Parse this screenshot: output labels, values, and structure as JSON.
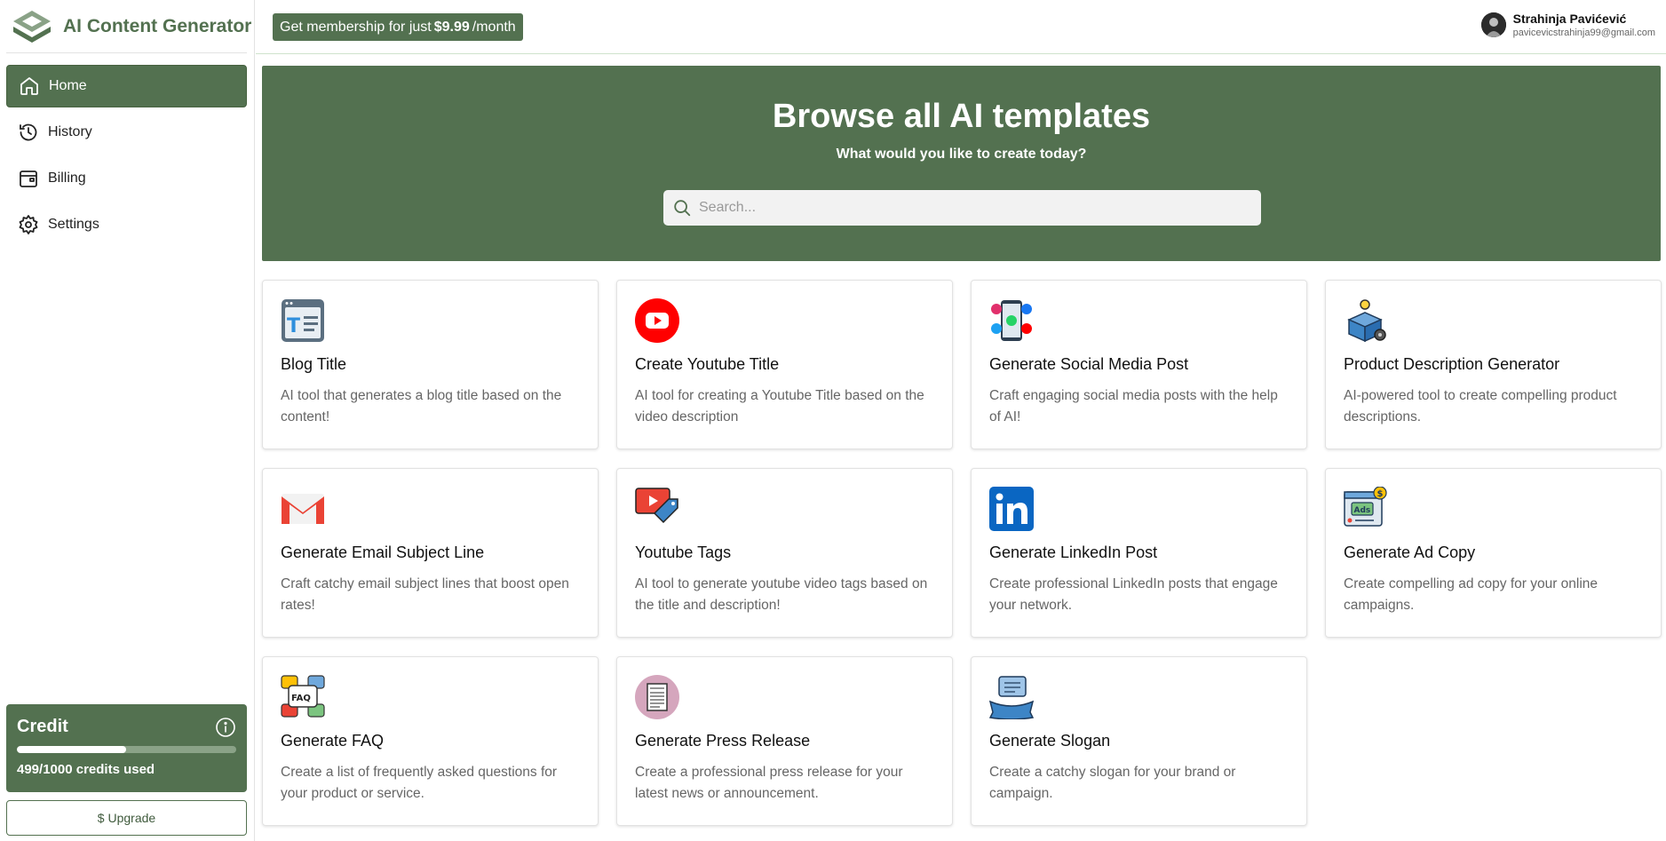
{
  "app": {
    "title": "AI Content Generator"
  },
  "sidebar": {
    "items": [
      {
        "label": "Home",
        "icon": "home-icon",
        "active": true
      },
      {
        "label": "History",
        "icon": "history-icon",
        "active": false
      },
      {
        "label": "Billing",
        "icon": "billing-icon",
        "active": false
      },
      {
        "label": "Settings",
        "icon": "gear-icon",
        "active": false
      }
    ]
  },
  "credit": {
    "title": "Credit",
    "used": 499,
    "total": 1000,
    "progress_fraction": 0.499,
    "text": "499/1000 credits used",
    "upgrade_label": "$ Upgrade"
  },
  "header": {
    "promo_prefix": "Get membership for just",
    "promo_price": "$9.99",
    "promo_suffix": "/month",
    "user_name": "Strahinja Pavićević",
    "user_email": "pavicevicstrahinja99@gmail.com"
  },
  "hero": {
    "title": "Browse all AI templates",
    "subtitle": "What would you like to create today?",
    "search_placeholder": "Search...",
    "search_value": ""
  },
  "templates": [
    {
      "title": "Blog Title",
      "desc": "AI tool that generates a blog title based on the content!",
      "icon": "blog-title-icon"
    },
    {
      "title": "Create Youtube Title",
      "desc": "AI tool for creating a Youtube Title based on the video description",
      "icon": "youtube-icon"
    },
    {
      "title": "Generate Social Media Post",
      "desc": "Craft engaging social media posts with the help of AI!",
      "icon": "social-media-icon"
    },
    {
      "title": "Product Description Generator",
      "desc": "AI-powered tool to create compelling product descriptions.",
      "icon": "product-box-icon"
    },
    {
      "title": "Generate Email Subject Line",
      "desc": "Craft catchy email subject lines that boost open rates!",
      "icon": "gmail-icon"
    },
    {
      "title": "Youtube Tags",
      "desc": "AI tool to generate youtube video tags based on the title and description!",
      "icon": "video-tag-icon"
    },
    {
      "title": "Generate LinkedIn Post",
      "desc": "Create professional LinkedIn posts that engage your network.",
      "icon": "linkedin-icon"
    },
    {
      "title": "Generate Ad Copy",
      "desc": "Create compelling ad copy for your online campaigns.",
      "icon": "ads-icon"
    },
    {
      "title": "Generate FAQ",
      "desc": "Create a list of frequently asked questions for your product or service.",
      "icon": "faq-icon"
    },
    {
      "title": "Generate Press Release",
      "desc": "Create a professional press release for your latest news or announcement.",
      "icon": "news-icon"
    },
    {
      "title": "Generate Slogan",
      "desc": "Create a catchy slogan for your brand or campaign.",
      "icon": "slogan-icon"
    }
  ],
  "colors": {
    "brand": "#537150",
    "youtube": "#ff0000",
    "linkedin": "#0a66c2"
  }
}
